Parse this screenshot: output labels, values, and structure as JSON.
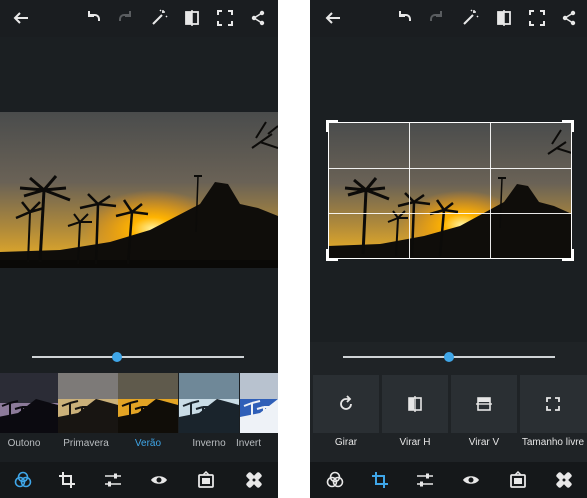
{
  "left_screen": {
    "toolbar_icons": [
      "back-arrow-icon",
      "undo-icon",
      "redo-icon",
      "magic-wand-icon",
      "compare-icon",
      "fullscreen-icon",
      "share-icon"
    ],
    "filters": [
      {
        "label": "Outono"
      },
      {
        "label": "Primavera"
      },
      {
        "label": "Verão"
      },
      {
        "label": "Inverno"
      },
      {
        "label": "Invert"
      }
    ],
    "selected_filter": "Verão",
    "slider_value": 0.4
  },
  "right_screen": {
    "toolbar_icons": [
      "back-arrow-icon",
      "undo-icon",
      "redo-icon",
      "magic-wand-icon",
      "compare-icon",
      "fullscreen-icon",
      "share-icon"
    ],
    "tools": [
      {
        "label": "Girar",
        "icon": "rotate-icon"
      },
      {
        "label": "Virar H",
        "icon": "flip-horizontal-icon"
      },
      {
        "label": "Virar V",
        "icon": "flip-vertical-icon"
      },
      {
        "label": "Tamanho livre",
        "icon": "free-size-icon"
      }
    ],
    "slider_value": 0.5
  },
  "bottom_nav": [
    "looks-icon",
    "crop-icon",
    "adjust-icon",
    "eye-icon",
    "frame-icon",
    "heal-icon"
  ],
  "colors": {
    "accent": "#3fa6e8",
    "background": "#1b1f22",
    "bar": "#15181a"
  }
}
